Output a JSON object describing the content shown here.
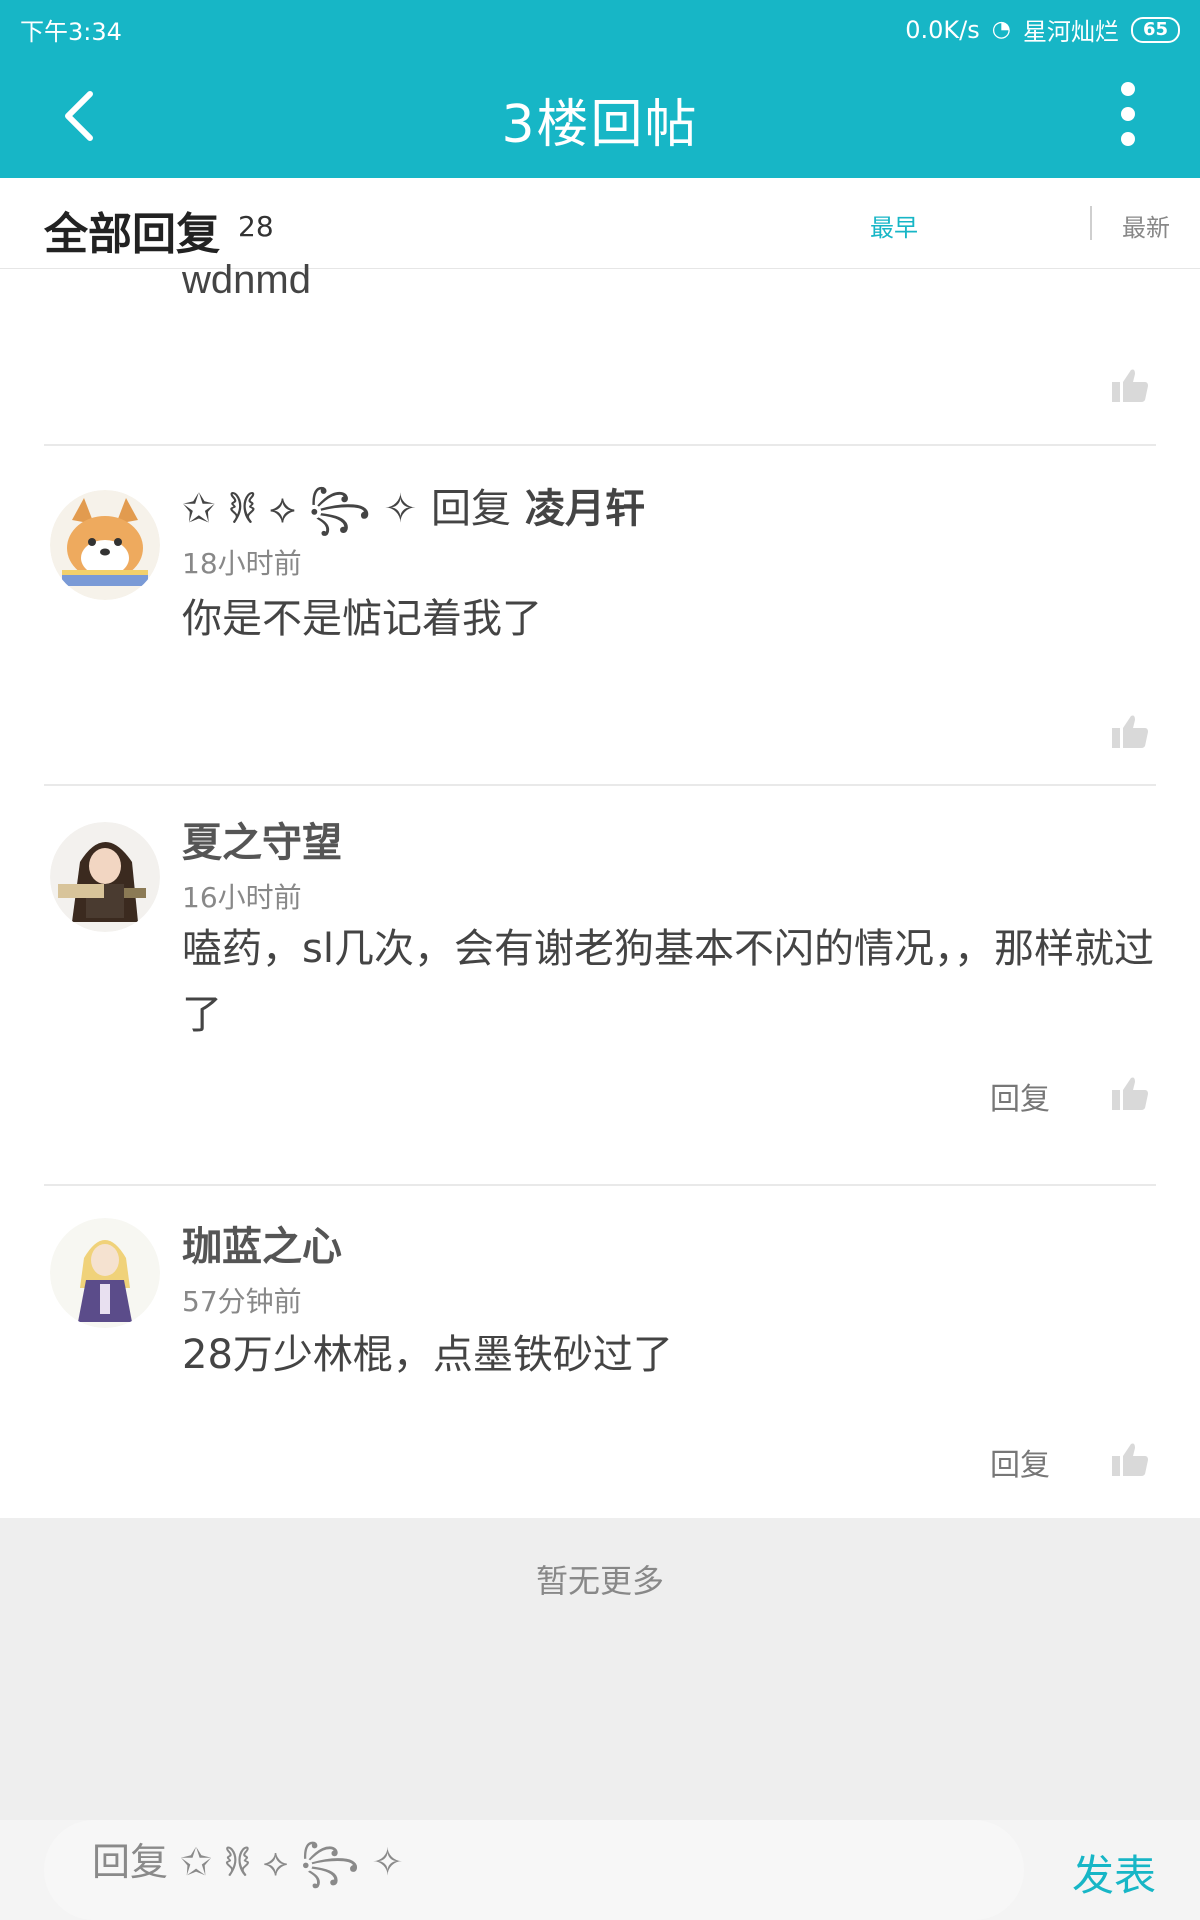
{
  "status": {
    "time": "下午3:34",
    "speed": "0.0K/s",
    "network": "星河灿烂",
    "battery": "65"
  },
  "header": {
    "title": "3楼回帖",
    "back_icon": "back-arrow-icon",
    "more_icon": "more-vertical-icon"
  },
  "replies": {
    "title": "全部回复",
    "count": "28",
    "sort_earliest": "最早",
    "sort_latest": "最新"
  },
  "partial_post": {
    "text": "wdnmd"
  },
  "posts": [
    {
      "name": "✩ 𐦍 ⟡ ꧂ ✧",
      "reply_word": "回复",
      "reply_to": "凌月轩",
      "time": "18小时前",
      "content": "你是不是惦记着我了",
      "reply_label": ""
    },
    {
      "name": "夏之守望",
      "time": "16小时前",
      "content": "嗑药，sl几次，会有谢老狗基本不闪的情况，，那样就过了",
      "reply_label": "回复"
    },
    {
      "name": "珈蓝之心",
      "time": "57分钟前",
      "content": "28万少林棍，点墨铁砂过了",
      "reply_label": "回复"
    }
  ],
  "footer": {
    "no_more": "暂无更多",
    "input_placeholder": "回复 ✩ 𐦍 ⟡ ꧂ ✧",
    "publish": "发表"
  },
  "colors": {
    "accent": "#17b6c6"
  }
}
